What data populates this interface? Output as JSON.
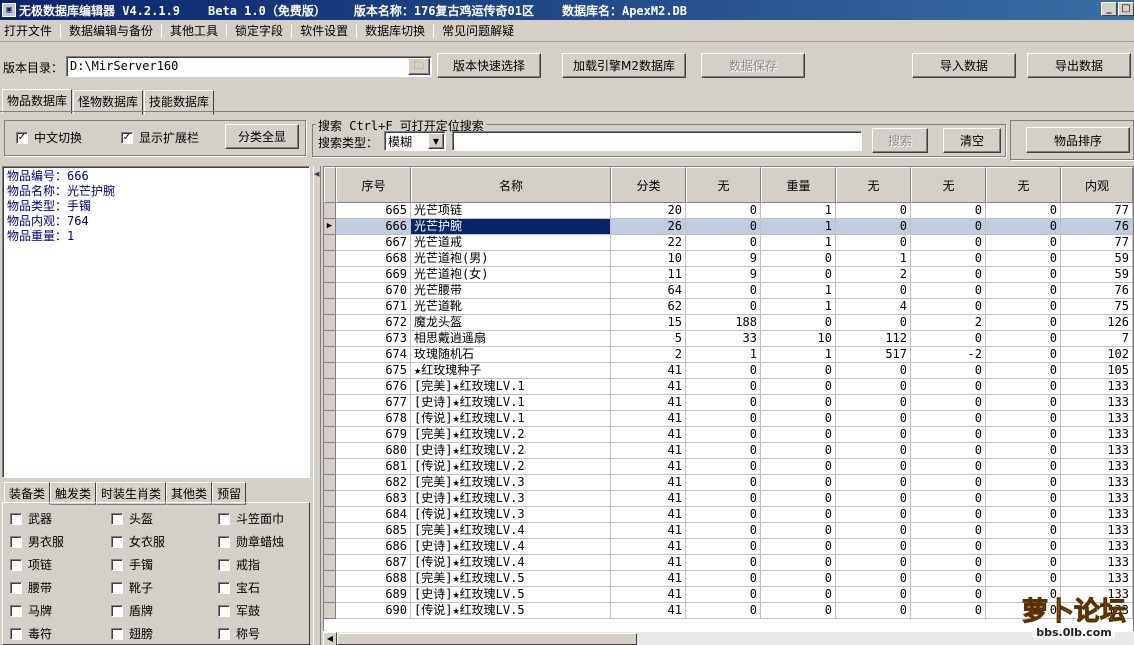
{
  "title": {
    "app": "无极数据库编辑器 V4.2.1.9",
    "beta": "Beta 1.0（免费版）",
    "version_name": "版本名称：176复古鸡运传奇01区",
    "db_name": "数据库名：ApexM2.DB"
  },
  "menu": [
    "打开文件",
    "数据编辑与备份",
    "其他工具",
    "锁定字段",
    "软件设置",
    "数据库切换",
    "常见问题解疑"
  ],
  "toolbar": {
    "dir_label": "版本目录：",
    "dir_value": "D:\\MirServer160",
    "quick_select": "版本快速选择",
    "load_db": "加载引擎M2数据库",
    "save": "数据保存",
    "import": "导入数据",
    "export": "导出数据"
  },
  "db_tabs": [
    "物品数据库",
    "怪物数据库",
    "技能数据库"
  ],
  "options": {
    "chinese": "中文切换",
    "show_ext": "显示扩展栏",
    "show_all": "分类全显"
  },
  "search": {
    "group_title": "搜索  Ctrl+F 可打开定位搜索",
    "type_label": "搜索类型：",
    "type_value": "模糊",
    "input_value": "",
    "search_btn": "搜索",
    "clear_btn": "清空",
    "sort_btn": "物品排序"
  },
  "info": [
    "物品编号：666",
    "物品名称：光芒护腕",
    "物品类型：手镯",
    "物品内观：764",
    "物品重量：1"
  ],
  "category_tabs": [
    "装备类",
    "触发类",
    "时装生肖类",
    "其他类",
    "预留"
  ],
  "categories": [
    [
      "武器",
      "头盔",
      "斗笠面巾"
    ],
    [
      "男衣服",
      "女衣服",
      "勋章蜡烛"
    ],
    [
      "项链",
      "手镯",
      "戒指"
    ],
    [
      "腰带",
      "靴子",
      "宝石"
    ],
    [
      "马牌",
      "盾牌",
      "军鼓"
    ],
    [
      "毒符",
      "翅膀",
      "称号"
    ]
  ],
  "table": {
    "columns": [
      "序号",
      "名称",
      "分类",
      "无",
      "重量",
      "无",
      "无",
      "无",
      "内观"
    ],
    "selected_index": 1,
    "rows": [
      [
        "665",
        "光芒项链",
        "20",
        "0",
        "1",
        "0",
        "0",
        "0",
        "77"
      ],
      [
        "666",
        "光芒护腕",
        "26",
        "0",
        "1",
        "0",
        "0",
        "0",
        "76"
      ],
      [
        "667",
        "光芒道戒",
        "22",
        "0",
        "1",
        "0",
        "0",
        "0",
        "77"
      ],
      [
        "668",
        "光芒道袍(男)",
        "10",
        "9",
        "0",
        "1",
        "0",
        "0",
        "59"
      ],
      [
        "669",
        "光芒道袍(女)",
        "11",
        "9",
        "0",
        "2",
        "0",
        "0",
        "59"
      ],
      [
        "670",
        "光芒腰带",
        "64",
        "0",
        "1",
        "0",
        "0",
        "0",
        "76"
      ],
      [
        "671",
        "光芒道靴",
        "62",
        "0",
        "1",
        "4",
        "0",
        "0",
        "75"
      ],
      [
        "672",
        "魔龙头盔",
        "15",
        "188",
        "0",
        "0",
        "2",
        "0",
        "126"
      ],
      [
        "673",
        "相思戴逍遥扇",
        "5",
        "33",
        "10",
        "112",
        "0",
        "0",
        "7"
      ],
      [
        "674",
        "玫瑰随机石",
        "2",
        "1",
        "1",
        "517",
        "-2",
        "0",
        "102"
      ],
      [
        "675",
        "★红玫瑰种子",
        "41",
        "0",
        "0",
        "0",
        "0",
        "0",
        "105"
      ],
      [
        "676",
        "[完美]★红玫瑰LV.1",
        "41",
        "0",
        "0",
        "0",
        "0",
        "0",
        "133"
      ],
      [
        "677",
        "[史诗]★红玫瑰LV.1",
        "41",
        "0",
        "0",
        "0",
        "0",
        "0",
        "133"
      ],
      [
        "678",
        "[传说]★红玫瑰LV.1",
        "41",
        "0",
        "0",
        "0",
        "0",
        "0",
        "133"
      ],
      [
        "679",
        "[完美]★红玫瑰LV.2",
        "41",
        "0",
        "0",
        "0",
        "0",
        "0",
        "133"
      ],
      [
        "680",
        "[史诗]★红玫瑰LV.2",
        "41",
        "0",
        "0",
        "0",
        "0",
        "0",
        "133"
      ],
      [
        "681",
        "[传说]★红玫瑰LV.2",
        "41",
        "0",
        "0",
        "0",
        "0",
        "0",
        "133"
      ],
      [
        "682",
        "[完美]★红玫瑰LV.3",
        "41",
        "0",
        "0",
        "0",
        "0",
        "0",
        "133"
      ],
      [
        "683",
        "[史诗]★红玫瑰LV.3",
        "41",
        "0",
        "0",
        "0",
        "0",
        "0",
        "133"
      ],
      [
        "684",
        "[传说]★红玫瑰LV.3",
        "41",
        "0",
        "0",
        "0",
        "0",
        "0",
        "133"
      ],
      [
        "685",
        "[完美]★红玫瑰LV.4",
        "41",
        "0",
        "0",
        "0",
        "0",
        "0",
        "133"
      ],
      [
        "686",
        "[史诗]★红玫瑰LV.4",
        "41",
        "0",
        "0",
        "0",
        "0",
        "0",
        "133"
      ],
      [
        "687",
        "[传说]★红玫瑰LV.4",
        "41",
        "0",
        "0",
        "0",
        "0",
        "0",
        "133"
      ],
      [
        "688",
        "[完美]★红玫瑰LV.5",
        "41",
        "0",
        "0",
        "0",
        "0",
        "0",
        "133"
      ],
      [
        "689",
        "[史诗]★红玫瑰LV.5",
        "41",
        "0",
        "0",
        "0",
        "0",
        "0",
        "133"
      ],
      [
        "690",
        "[传说]★红玫瑰LV.5",
        "41",
        "0",
        "0",
        "0",
        "0",
        "0",
        "133"
      ]
    ]
  },
  "watermark": {
    "logo": "萝卜论坛",
    "url": "bbs.0lb.com"
  },
  "icons": {
    "folder": "folder-icon",
    "dropdown": "chevron-down-icon",
    "row_pointer": "triangle-right-icon"
  },
  "colors": {
    "titlebar": "#0a246a",
    "selection": "#0a246a",
    "info_text": "#000080"
  }
}
